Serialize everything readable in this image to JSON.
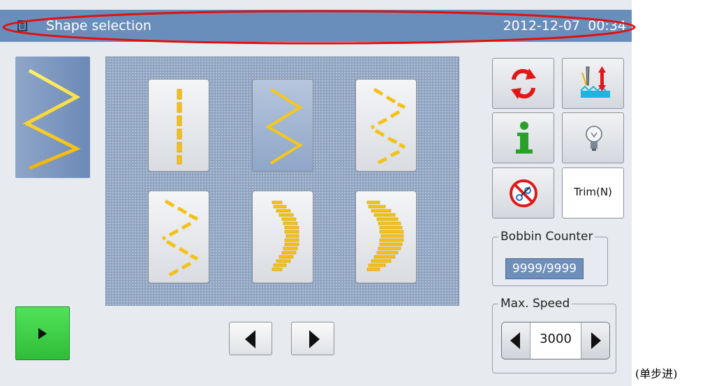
{
  "titlebar": {
    "title": "Shape selection",
    "date": "2012-12-07",
    "time": "00:34",
    "icon": "document-icon",
    "bg_color": "#6a8ebc"
  },
  "annotation": {
    "color": "#e01010"
  },
  "preview": {
    "pattern": "zigzag"
  },
  "patterns": [
    {
      "name": "dashed-straight",
      "selected": false
    },
    {
      "name": "zigzag",
      "selected": true
    },
    {
      "name": "dashed-zigzag",
      "selected": false
    },
    {
      "name": "dashed-zigzag-wide",
      "selected": false
    },
    {
      "name": "curved-bars-left",
      "selected": false
    },
    {
      "name": "curved-bars-right",
      "selected": false
    }
  ],
  "right_buttons": [
    {
      "name": "rotate-icon",
      "label": ""
    },
    {
      "name": "needle-height-icon",
      "label": ""
    },
    {
      "name": "info-icon",
      "label": ""
    },
    {
      "name": "lightbulb-icon",
      "label": ""
    },
    {
      "name": "no-trim-icon",
      "label": ""
    },
    {
      "name": "trim",
      "label": "Trim(N)"
    }
  ],
  "bobbin": {
    "label": "Bobbin Counter",
    "value": "9999/9999"
  },
  "speed": {
    "label": "Max. Speed",
    "value": "3000"
  },
  "nav": {
    "prev": "chevron-left-icon",
    "next": "chevron-right-icon"
  },
  "play": {
    "icon": "play-icon",
    "color": "#3fd046"
  },
  "caption": "(单步进)"
}
